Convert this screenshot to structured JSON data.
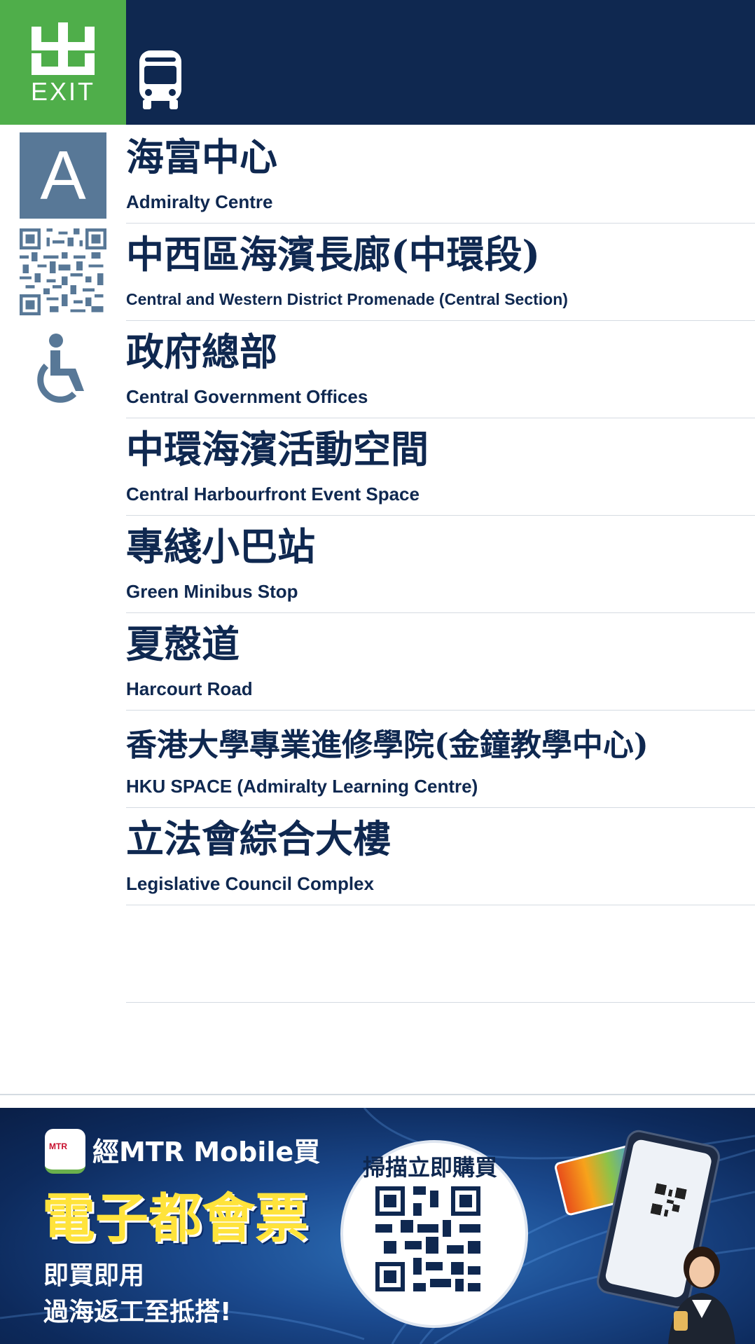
{
  "header": {
    "exit_label": "EXIT",
    "exit_glyph_name": "exit-character-icon",
    "transport_icon": "bus-icon",
    "colors": {
      "bar": "#0f2850",
      "exit_box": "#4fae4a"
    }
  },
  "exit": {
    "letter": "A",
    "badge_color": "#587897",
    "qr_icon": "qr-code-icon",
    "accessibility_icon": "wheelchair-icon"
  },
  "destinations": [
    {
      "zh": "海富中心",
      "en": "Admiralty Centre"
    },
    {
      "zh": "中西區海濱長廊(中環段)",
      "en": "Central and Western District Promenade (Central Section)"
    },
    {
      "zh": "政府總部",
      "en": "Central Government Offices"
    },
    {
      "zh": "中環海濱活動空間",
      "en": "Central Harbourfront Event Space"
    },
    {
      "zh": "專綫小巴站",
      "en": "Green Minibus Stop"
    },
    {
      "zh": "夏慤道",
      "en": "Harcourt Road"
    },
    {
      "zh": "香港大學專業進修學院(金鐘教學中心)",
      "en": "HKU SPACE (Admiralty Learning Centre)"
    },
    {
      "zh": "立法會綜合大樓",
      "en": "Legislative Council Complex"
    }
  ],
  "ad": {
    "app_icon_text": "MTR",
    "headline": "經MTR Mobile買",
    "title": "電子都會票",
    "line1": "即買即用",
    "line2": "過海返工至抵搭!",
    "scan_label": "掃描立即購買",
    "qr_icon": "qr-code-icon"
  }
}
